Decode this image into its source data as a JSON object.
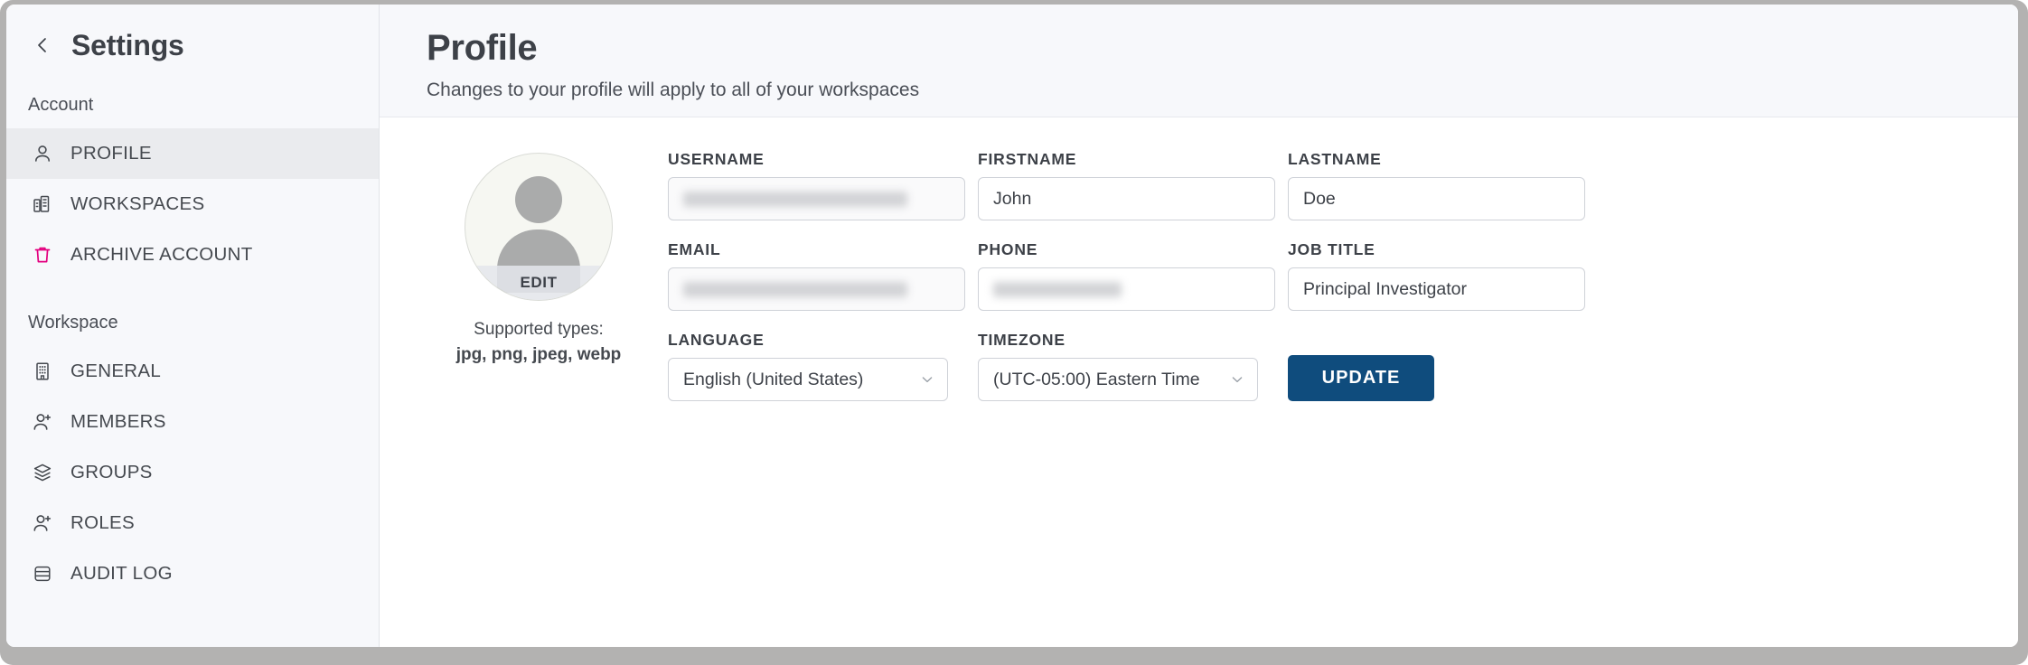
{
  "window": {
    "frame_color": "#b3b2b1"
  },
  "sidebar": {
    "title": "Settings",
    "back_icon": "chevron-left-icon",
    "sections": [
      {
        "label": "Account",
        "items": [
          {
            "label": "PROFILE",
            "icon": "user-icon",
            "active": true
          },
          {
            "label": "WORKSPACES",
            "icon": "buildings-icon",
            "active": false
          },
          {
            "label": "ARCHIVE ACCOUNT",
            "icon": "trash-icon",
            "active": false,
            "icon_color": "#e3007f"
          }
        ]
      },
      {
        "label": "Workspace",
        "items": [
          {
            "label": "GENERAL",
            "icon": "building-icon",
            "active": false
          },
          {
            "label": "MEMBERS",
            "icon": "user-plus-icon",
            "active": false
          },
          {
            "label": "GROUPS",
            "icon": "layers-icon",
            "active": false
          },
          {
            "label": "ROLES",
            "icon": "user-plus-icon",
            "active": false
          },
          {
            "label": "AUDIT LOG",
            "icon": "database-icon",
            "active": false
          }
        ]
      }
    ]
  },
  "header": {
    "title": "Profile",
    "subtitle": "Changes to your profile will apply to all of your workspaces"
  },
  "avatar": {
    "edit_label": "EDIT",
    "supported_types_label": "Supported types:",
    "supported_types_value": "jpg, png, jpeg, webp"
  },
  "form": {
    "username": {
      "label": "USERNAME",
      "value": "",
      "redacted": true,
      "disabled": true
    },
    "firstname": {
      "label": "FIRSTNAME",
      "value": "John",
      "redacted": false,
      "disabled": false
    },
    "lastname": {
      "label": "LASTNAME",
      "value": "Doe",
      "redacted": false,
      "disabled": false
    },
    "email": {
      "label": "EMAIL",
      "value": "",
      "redacted": true,
      "disabled": true
    },
    "phone": {
      "label": "PHONE",
      "value": "",
      "redacted": true,
      "disabled": false
    },
    "jobtitle": {
      "label": "JOB TITLE",
      "value": "Principal Investigator",
      "redacted": false,
      "disabled": false
    },
    "language": {
      "label": "LANGUAGE",
      "value": "English (United States)"
    },
    "timezone": {
      "label": "TIMEZONE",
      "value": "(UTC-05:00) Eastern Time"
    },
    "update_button": {
      "label": "UPDATE",
      "color": "#0f4c7d"
    }
  }
}
